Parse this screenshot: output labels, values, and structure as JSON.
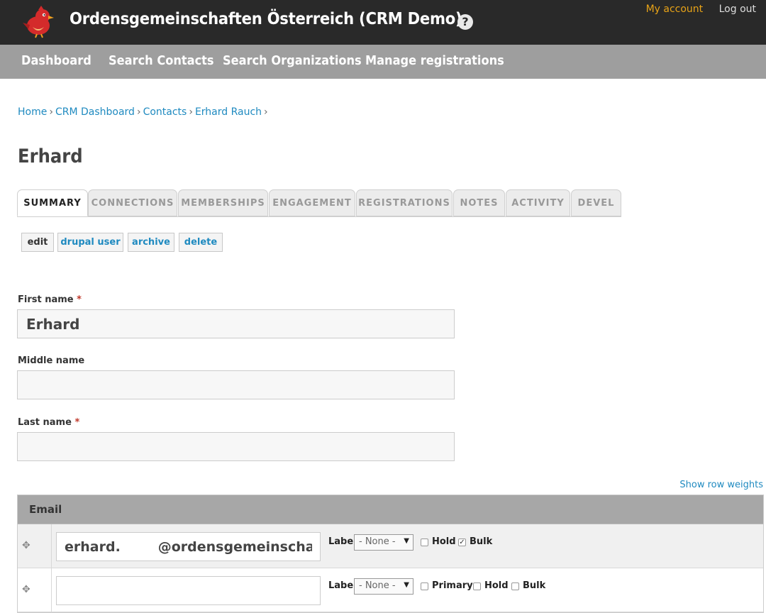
{
  "header": {
    "site_title": "Ordensgemeinschaften Österreich (CRM Demo)",
    "help": "?",
    "my_account": "My account",
    "log_out": "Log out"
  },
  "nav": {
    "items": [
      "Dashboard",
      "Search Contacts",
      "Search Organizations",
      "Manage registrations"
    ]
  },
  "breadcrumb": [
    "Home",
    "CRM Dashboard",
    "Contacts",
    "Erhard Rauch"
  ],
  "breadcrumb_sep": "›",
  "page_title": "Erhard",
  "tabs": [
    "SUMMARY",
    "CONNECTIONS",
    "MEMBERSHIPS",
    "ENGAGEMENT",
    "REGISTRATIONS",
    "NOTES",
    "ACTIVITY",
    "DEVEL"
  ],
  "actions": [
    "edit",
    "drupal user",
    "archive",
    "delete"
  ],
  "form": {
    "first_name_label": "First name",
    "first_name_value": "Erhard",
    "middle_name_label": "Middle name",
    "middle_name_value": "",
    "last_name_label": "Last name",
    "last_name_value": "",
    "required_mark": "*"
  },
  "show_row_weights": "Show row weights",
  "email": {
    "header": "Email",
    "rows": [
      {
        "value": "erhard.        @ordensgemeinschaften.at",
        "label_text": "Label",
        "select_value": "- None -",
        "hold_label": "Hold",
        "bulk_label": "Bulk",
        "hold_checked": false,
        "bulk_checked": true
      },
      {
        "value": "",
        "label_text": "Label",
        "select_value": "- None -",
        "primary_label": "Primary",
        "hold_label": "Hold",
        "bulk_label": "Bulk",
        "primary_checked": false,
        "hold_checked": false,
        "bulk_checked": false
      }
    ]
  },
  "colors": {
    "header_bg": "#292929",
    "nav_bg": "#9e9e9e",
    "link": "#1f8ac0",
    "accent": "#e8a317"
  }
}
